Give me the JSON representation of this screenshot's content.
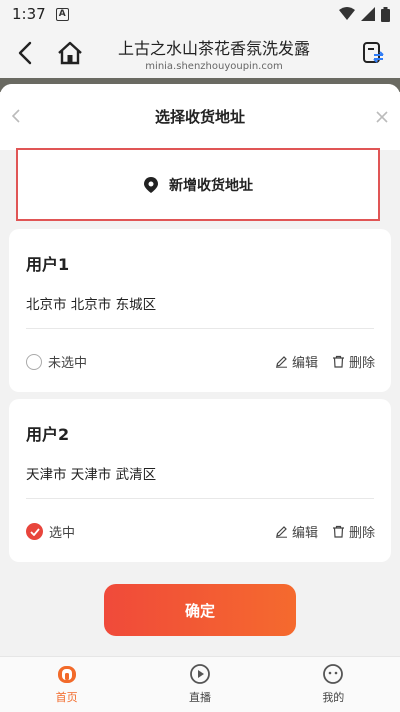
{
  "status_bar": {
    "time": "1:37"
  },
  "browser": {
    "title": "上古之水山茶花香氛洗发露",
    "url": "minia.shenzhouyoupin.com"
  },
  "sheet": {
    "title": "选择收货地址",
    "add_label": "新增收货地址"
  },
  "addresses": [
    {
      "name": "用户1",
      "address": "北京市 北京市 东城区",
      "select_label": "未选中",
      "selected": false,
      "edit_label": "编辑",
      "delete_label": "删除"
    },
    {
      "name": "用户2",
      "address": "天津市 天津市 武清区",
      "select_label": "选中",
      "selected": true,
      "edit_label": "编辑",
      "delete_label": "删除"
    }
  ],
  "confirm_label": "确定",
  "tabs": [
    {
      "label": "首页",
      "icon": "home-icon",
      "active": true
    },
    {
      "label": "直播",
      "icon": "live-icon",
      "active": false
    },
    {
      "label": "我的",
      "icon": "profile-icon",
      "active": false
    }
  ],
  "colors": {
    "accent": "#f26a2a",
    "red": "#e8453c",
    "highlight_border": "#e05555"
  }
}
